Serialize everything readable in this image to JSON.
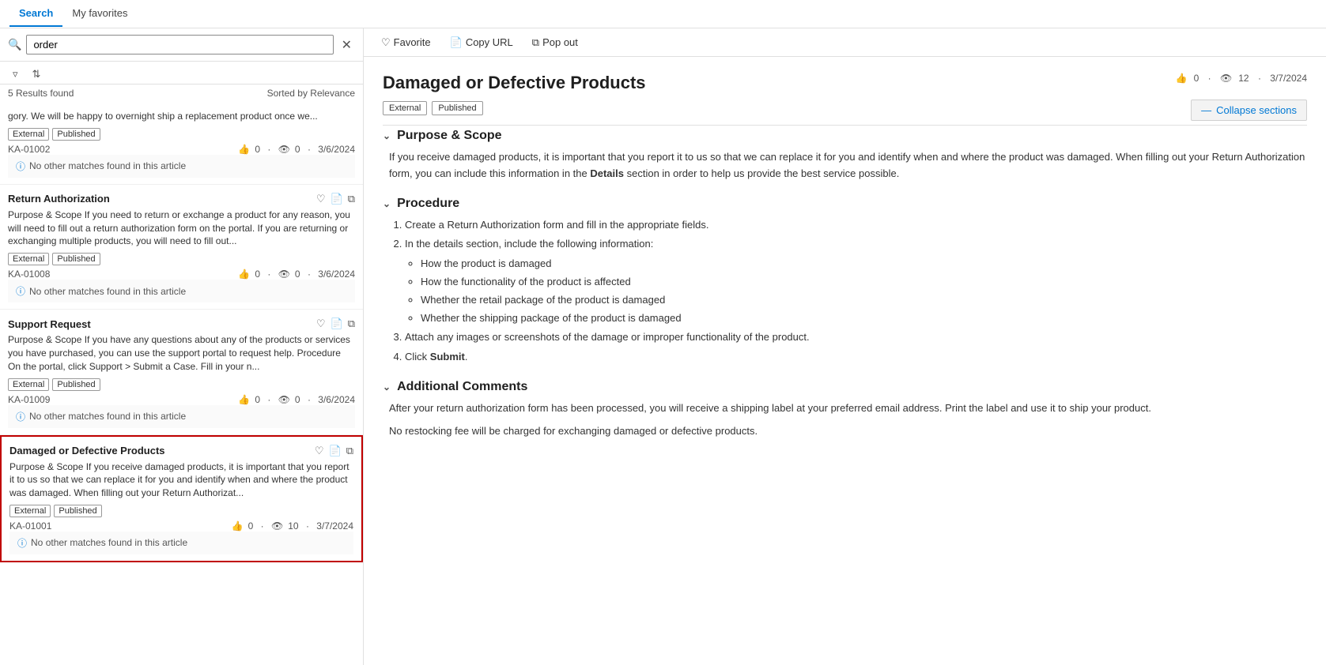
{
  "tabs": {
    "search": "Search",
    "favorites": "My favorites"
  },
  "topbar": {
    "favorite_label": "Favorite",
    "copy_label": "Copy URL",
    "popout_label": "Pop out"
  },
  "search": {
    "placeholder": "order",
    "results_summary": "5 Results found",
    "sort_label": "Sorted by Relevance"
  },
  "results": [
    {
      "id": "r1",
      "title": null,
      "excerpt": "gory. We will be happy to overnight ship a replacement product once we...",
      "tags": [
        "External",
        "Published"
      ],
      "ka_id": "KA-01002",
      "likes": "0",
      "views": "0",
      "date": "3/6/2024",
      "no_match": "No other matches found in this article",
      "selected": false
    },
    {
      "id": "r2",
      "title": "Return Authorization",
      "excerpt": "Purpose & Scope If you need to return or exchange a product for any reason, you will need to fill out a return authorization form on the portal. If you are returning or exchanging multiple products, you will need to fill out...",
      "tags": [
        "External",
        "Published"
      ],
      "ka_id": "KA-01008",
      "likes": "0",
      "views": "0",
      "date": "3/6/2024",
      "no_match": "No other matches found in this article",
      "selected": false
    },
    {
      "id": "r3",
      "title": "Support Request",
      "excerpt": "Purpose & Scope If you have any questions about any of the products or services you have purchased, you can use the support portal to request help. Procedure On the portal, click Support > Submit a Case. Fill in your n...",
      "tags": [
        "External",
        "Published"
      ],
      "ka_id": "KA-01009",
      "likes": "0",
      "views": "0",
      "date": "3/6/2024",
      "no_match": "No other matches found in this article",
      "selected": false
    },
    {
      "id": "r4",
      "title": "Damaged or Defective Products",
      "excerpt": "Purpose & Scope If you receive damaged products, it is important that you report it to us so that we can replace it for you and identify when and where the product was damaged. When filling out your Return Authorizat...",
      "tags": [
        "External",
        "Published"
      ],
      "ka_id": "KA-01001",
      "likes": "0",
      "views": "10",
      "date": "3/7/2024",
      "no_match": "No other matches found in this article",
      "selected": true
    }
  ],
  "article": {
    "title": "Damaged or Defective Products",
    "tags": [
      "External",
      "Published"
    ],
    "likes": "0",
    "views": "12",
    "date": "3/7/2024",
    "collapse_label": "Collapse sections",
    "sections": [
      {
        "heading": "Purpose & Scope",
        "body": "If you receive damaged products, it is important that you report it to us so that we can replace it for you and identify when and where the product was damaged. When filling out your Return Authorization form, you can include this information in the Details section in order to help us provide the best service possible."
      },
      {
        "heading": "Procedure",
        "ordered_items": [
          "Create a Return Authorization form and fill in the appropriate fields.",
          "In the details section, include the following information:",
          "Attach any images or screenshots of the damage or improper functionality of the product.",
          "Click Submit."
        ],
        "sub_items": [
          "How the product is damaged",
          "How the functionality of the product is affected",
          "Whether the retail package of the product is damaged",
          "Whether the shipping package of the product is damaged"
        ]
      },
      {
        "heading": "Additional Comments",
        "body1": "After your return authorization form has been processed, you will receive a shipping label at your preferred email address. Print the label and use it to ship your product.",
        "body2": "No restocking fee will be charged for exchanging damaged or defective products."
      }
    ]
  }
}
